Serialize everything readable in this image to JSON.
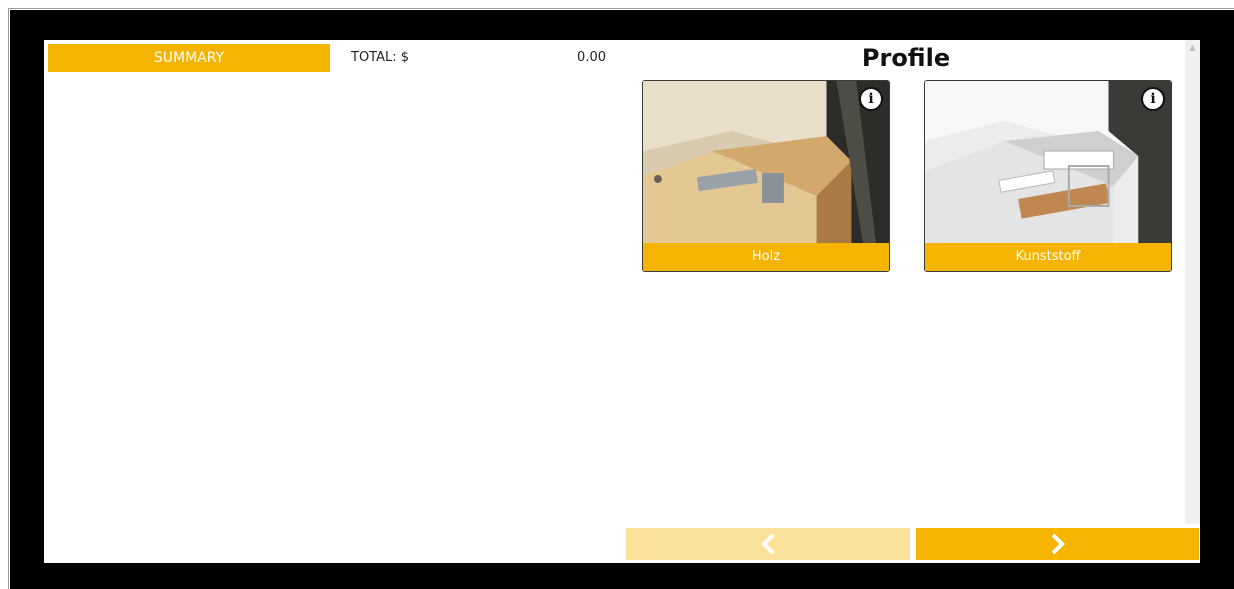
{
  "summary": {
    "button_label": "SUMMARY",
    "total_label": "TOTAL: $",
    "total_value": "0.00"
  },
  "panel": {
    "title": "Profile",
    "options": [
      {
        "label": "Holz",
        "icon": "info-icon"
      },
      {
        "label": "Kunststoff",
        "icon": "info-icon"
      }
    ]
  },
  "nav": {
    "prev_icon": "chevron-left-icon",
    "next_icon": "chevron-right-icon"
  },
  "colors": {
    "accent": "#f5b400",
    "accent_disabled": "#fbe29a",
    "frame": "#000000"
  }
}
